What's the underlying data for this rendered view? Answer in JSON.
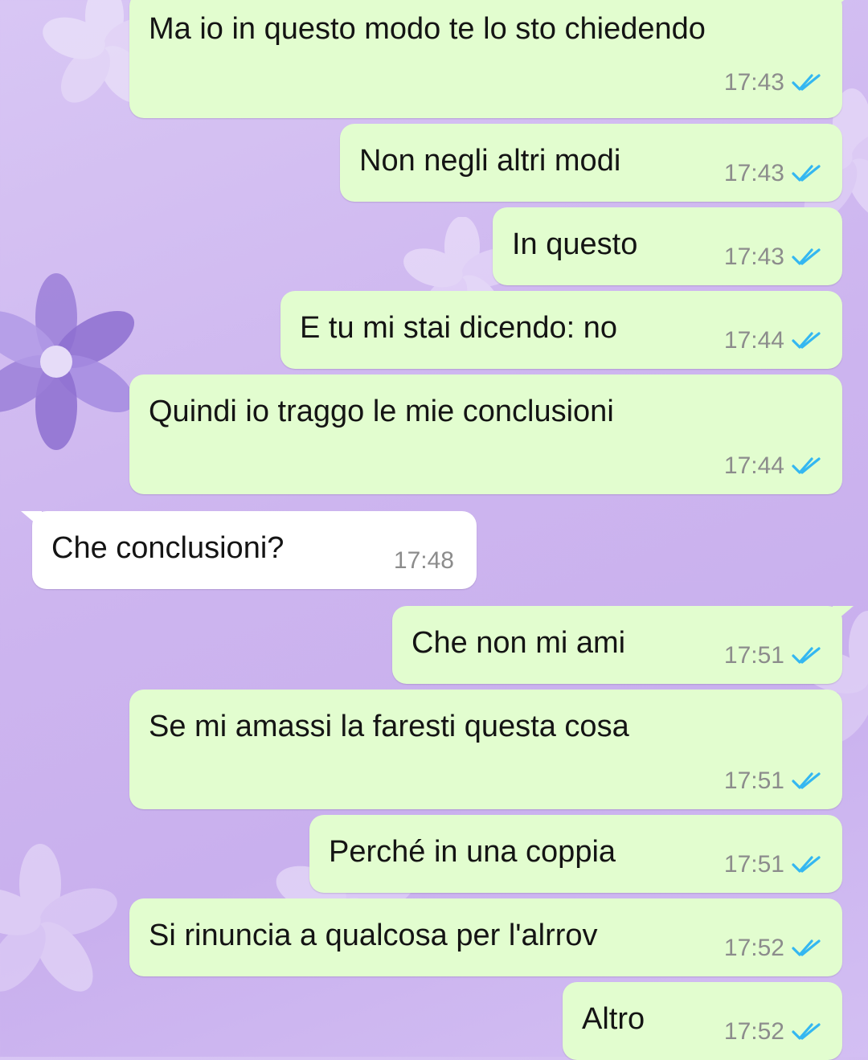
{
  "colors": {
    "outgoing_bubble": "#e2fdcf",
    "incoming_bubble": "#ffffff",
    "read_ticks": "#34b7f1",
    "time_text": "#8c8c8c",
    "wallpaper": "#cdb5ef"
  },
  "messages": [
    {
      "text": "Ma io in questo modo te lo sto chiedendo",
      "time": "17:43",
      "direction": "outgoing",
      "status": "read"
    },
    {
      "text": "Non negli altri modi",
      "time": "17:43",
      "direction": "outgoing",
      "status": "read"
    },
    {
      "text": "In questo",
      "time": "17:43",
      "direction": "outgoing",
      "status": "read"
    },
    {
      "text": "E tu mi stai dicendo: no",
      "time": "17:44",
      "direction": "outgoing",
      "status": "read"
    },
    {
      "text": "Quindi io traggo le mie conclusioni",
      "time": "17:44",
      "direction": "outgoing",
      "status": "read"
    },
    {
      "text": "Che conclusioni?",
      "time": "17:48",
      "direction": "incoming"
    },
    {
      "text": "Che non mi ami",
      "time": "17:51",
      "direction": "outgoing",
      "status": "read"
    },
    {
      "text": "Se mi amassi la faresti questa cosa",
      "time": "17:51",
      "direction": "outgoing",
      "status": "read"
    },
    {
      "text": "Perché in una coppia",
      "time": "17:51",
      "direction": "outgoing",
      "status": "read"
    },
    {
      "text": "Si rinuncia a qualcosa per l'alrrov",
      "time": "17:52",
      "direction": "outgoing",
      "status": "read"
    },
    {
      "text": "Altro",
      "time": "17:52",
      "direction": "outgoing",
      "status": "read"
    }
  ]
}
